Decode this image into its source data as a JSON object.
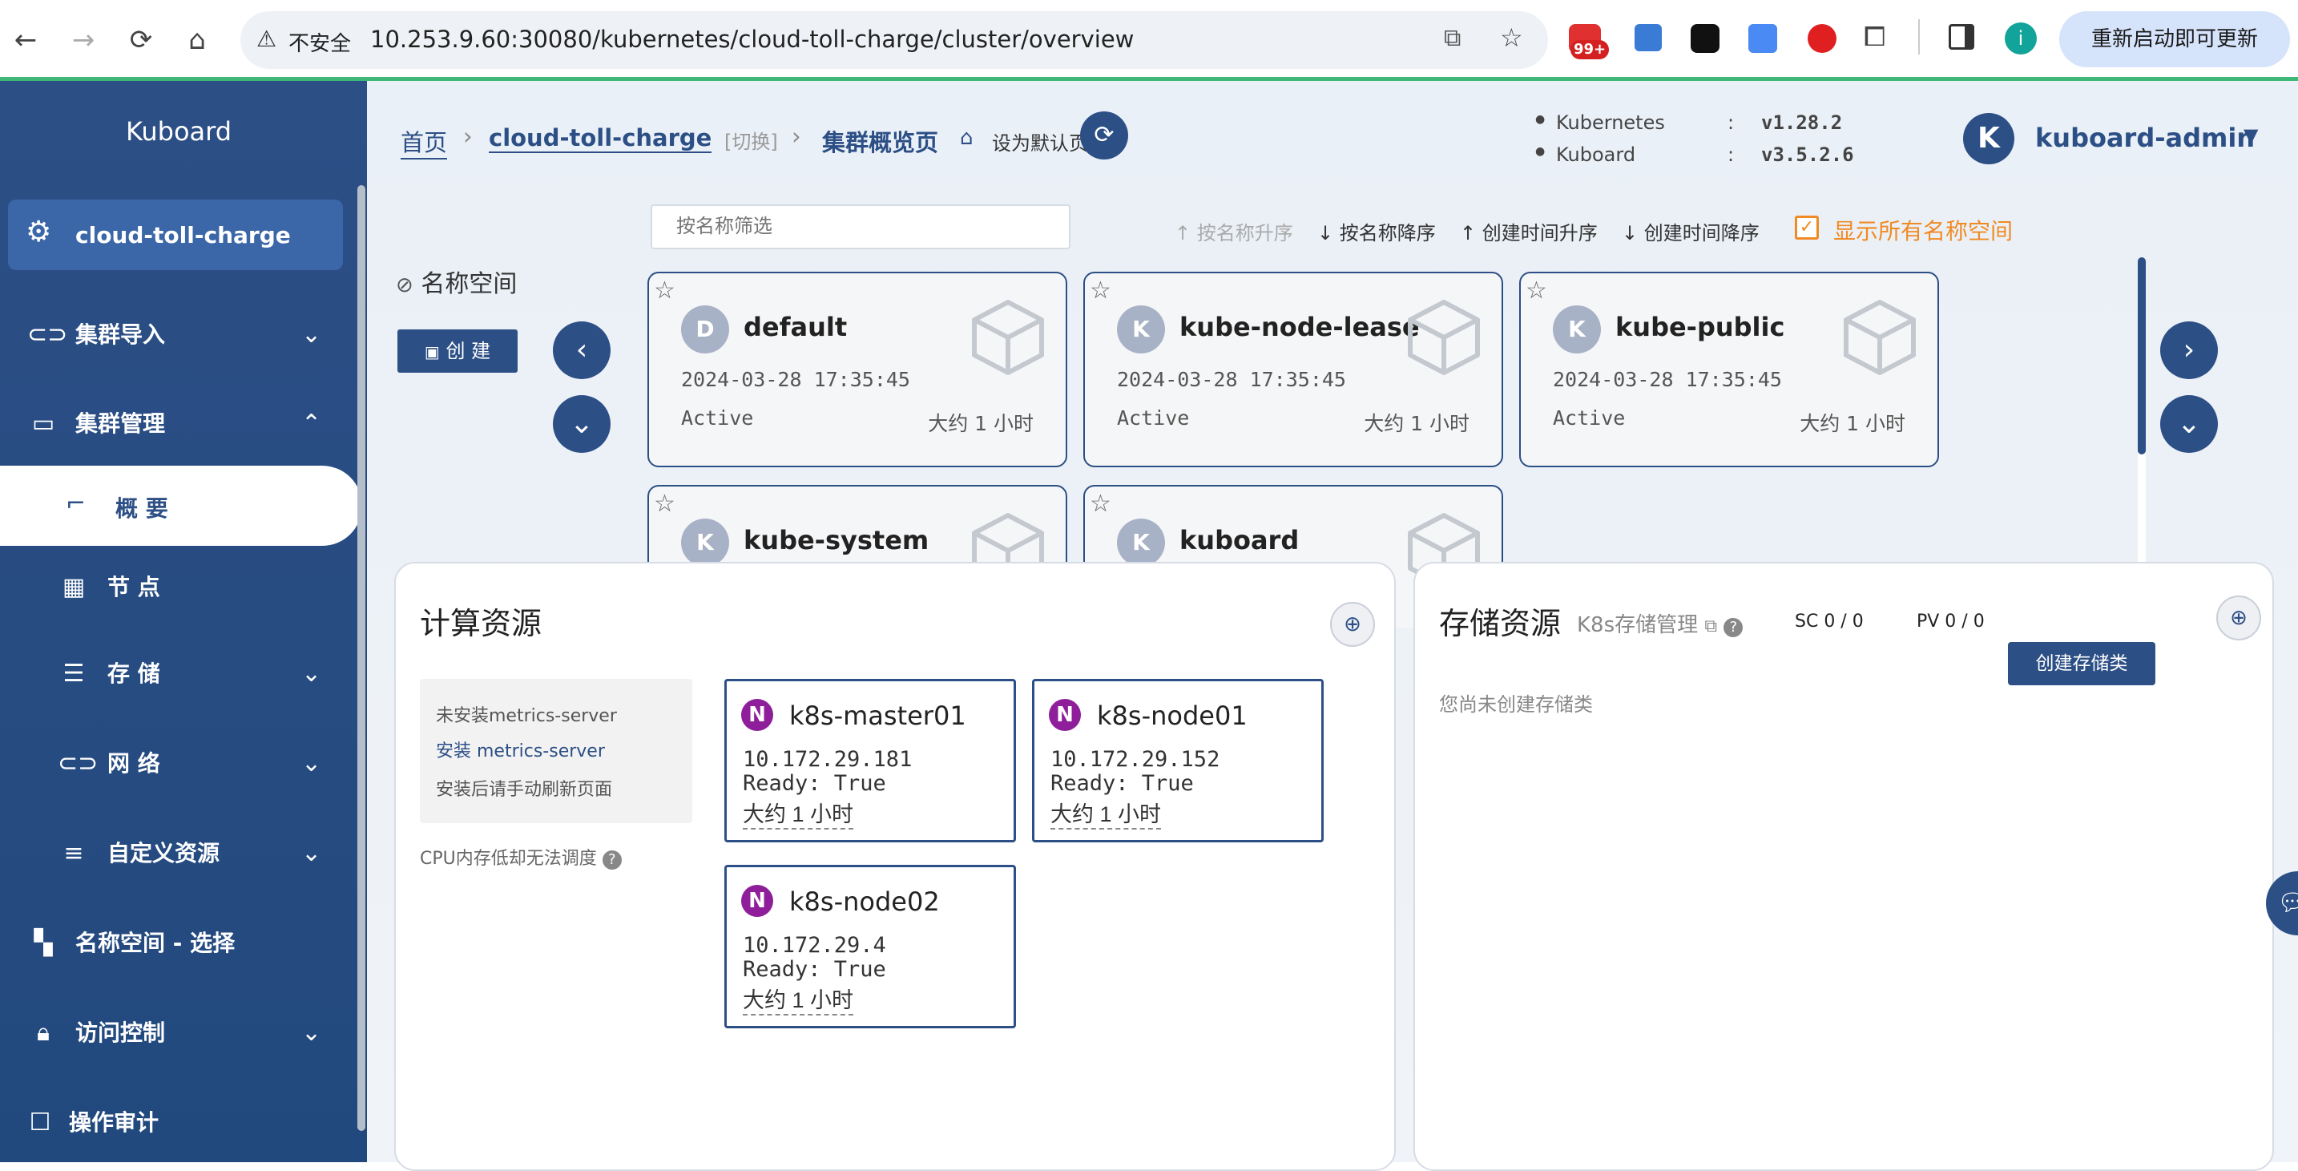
{
  "browser": {
    "insecure_label": "不安全",
    "url": "10.253.9.60:30080/kubernetes/cloud-toll-charge/cluster/overview",
    "badge": "99+",
    "profile_initial": "i",
    "update_button": "重新启动即可更新"
  },
  "sidebar": {
    "logo": "Kuboard",
    "cluster": "cloud-toll-charge",
    "items": [
      {
        "label": "集群导入",
        "icon": "link-icon"
      },
      {
        "label": "集群管理",
        "icon": "layers-icon"
      },
      {
        "label": "概 要",
        "icon": "presentation-icon"
      },
      {
        "label": "节 点",
        "icon": "grid-icon"
      },
      {
        "label": "存 储",
        "icon": "database-icon"
      },
      {
        "label": "网 络",
        "icon": "network-icon"
      },
      {
        "label": "自定义资源",
        "icon": "sliders-icon"
      },
      {
        "label": "名称空间 - 选择",
        "icon": "apps-icon"
      },
      {
        "label": "访问控制",
        "icon": "lock-icon"
      },
      {
        "label": "操作审计",
        "icon": "audit-icon"
      }
    ]
  },
  "breadcrumb": {
    "home": "首页",
    "cluster": "cloud-toll-charge",
    "switch": "[切换]",
    "page": "集群概览页",
    "set_default": "设为默认页"
  },
  "versions": {
    "k8s_label": "Kubernetes",
    "k8s_value": "v1.28.2",
    "kuboard_label": "Kuboard",
    "kuboard_value": "v3.5.2.6",
    "sep": ":"
  },
  "user": {
    "initial": "K",
    "name": "kuboard-admin"
  },
  "namespace": {
    "title": "名称空间",
    "create_button": "创 建",
    "filter_placeholder": "按名称筛选",
    "sort": [
      "按名称升序",
      "按名称降序",
      "创建时间升序",
      "创建时间降序"
    ],
    "show_all": "显示所有名称空间",
    "cards": [
      {
        "initial": "D",
        "name": "default",
        "time": "2024-03-28 17:35:45",
        "status": "Active",
        "age": "大约 1 小时"
      },
      {
        "initial": "K",
        "name": "kube-node-lease",
        "time": "2024-03-28 17:35:45",
        "status": "Active",
        "age": "大约 1 小时"
      },
      {
        "initial": "K",
        "name": "kube-public",
        "time": "2024-03-28 17:35:45",
        "status": "Active",
        "age": "大约 1 小时"
      },
      {
        "initial": "K",
        "name": "kube-system",
        "time": "",
        "status": "",
        "age": ""
      },
      {
        "initial": "K",
        "name": "kuboard",
        "time": "",
        "status": "",
        "age": ""
      }
    ]
  },
  "compute": {
    "title": "计算资源",
    "metrics": {
      "line1": "未安装metrics-server",
      "line2": "安装 metrics-server",
      "line3": "安装后请手动刷新页面"
    },
    "cpu_note": "CPU内存低却无法调度",
    "nodes": [
      {
        "badge": "N",
        "name": "k8s-master01",
        "ip": "10.172.29.181",
        "ready": "Ready: True",
        "age": "大约 1 小时"
      },
      {
        "badge": "N",
        "name": "k8s-node01",
        "ip": "10.172.29.152",
        "ready": "Ready: True",
        "age": "大约 1 小时"
      },
      {
        "badge": "N",
        "name": "k8s-node02",
        "ip": "10.172.29.4",
        "ready": "Ready: True",
        "age": "大约 1 小时"
      }
    ]
  },
  "storage": {
    "title": "存储资源",
    "link": "K8s存储管理",
    "sc": "SC 0 / 0",
    "pv": "PV 0 / 0",
    "create_button": "创建存储类",
    "empty": "您尚未创建存储类"
  },
  "colors": {
    "primary": "#2c4f86",
    "accent": "#f08a24",
    "node_badge": "#8e1e9a",
    "green_bar": "#3db878"
  }
}
